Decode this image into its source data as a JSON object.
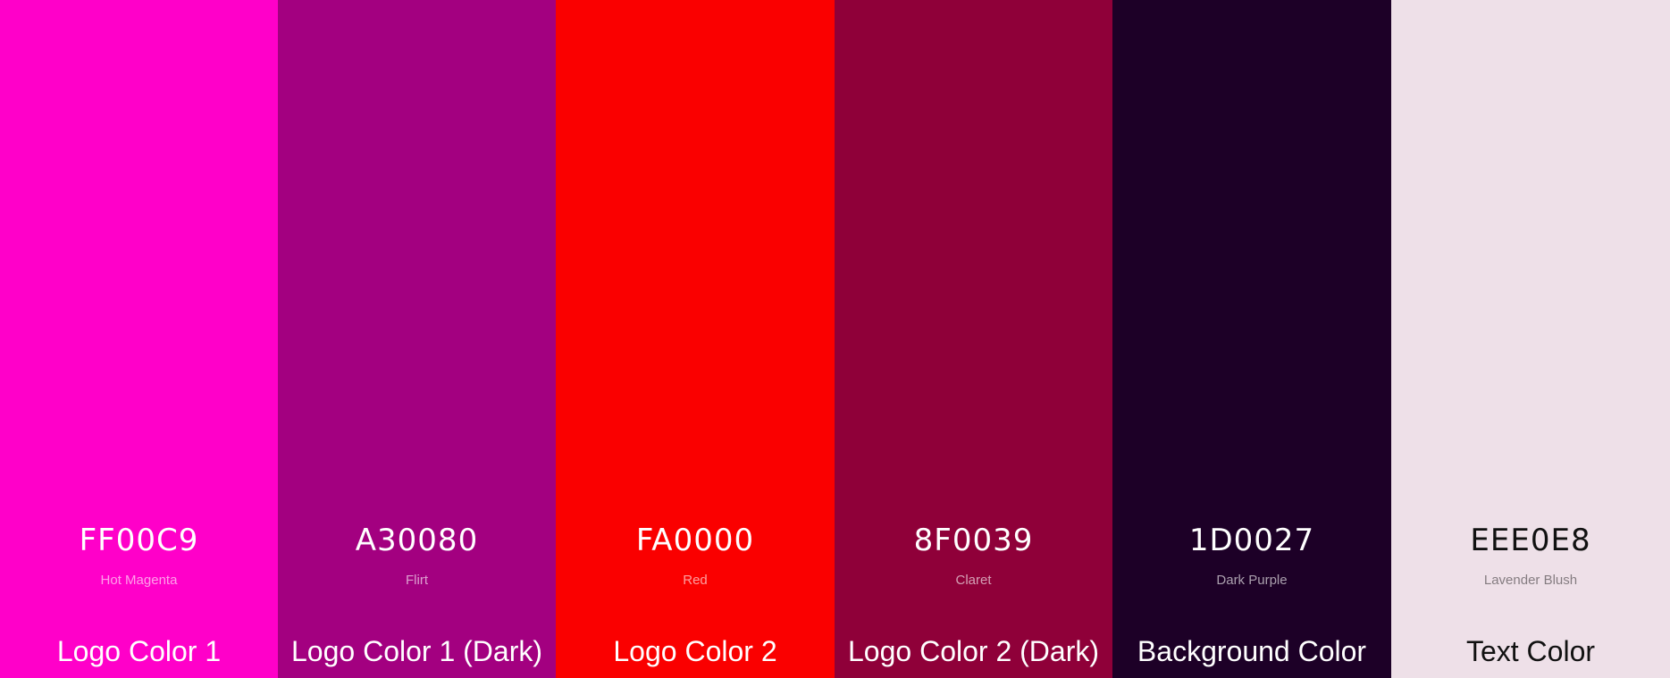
{
  "swatches": [
    {
      "hex": "FF00C9",
      "name": "Hot Magenta",
      "role": "Logo Color 1",
      "color": "#FF00C9"
    },
    {
      "hex": "A30080",
      "name": "Flirt",
      "role": "Logo Color 1 (Dark)",
      "color": "#A30080"
    },
    {
      "hex": "FA0000",
      "name": "Red",
      "role": "Logo Color 2",
      "color": "#FA0000"
    },
    {
      "hex": "8F0039",
      "name": "Claret",
      "role": "Logo Color 2 (Dark)",
      "color": "#8F0039"
    },
    {
      "hex": "1D0027",
      "name": "Dark Purple",
      "role": "Background Color",
      "color": "#1D0027"
    },
    {
      "hex": "EEE0E8",
      "name": "Lavender Blush",
      "role": "Text Color",
      "color": "#EEE0E8"
    }
  ]
}
